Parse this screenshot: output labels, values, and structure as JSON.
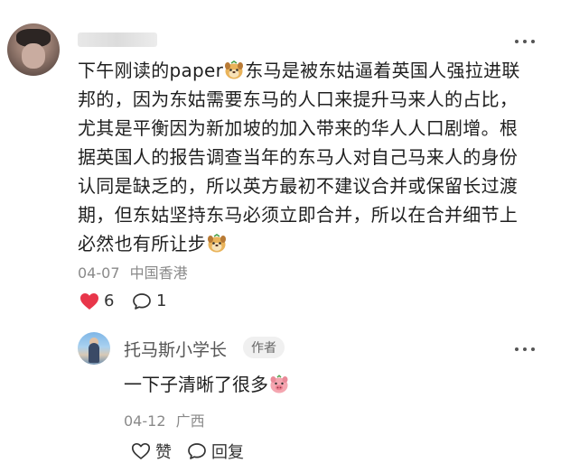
{
  "comment": {
    "author_blurred": true,
    "text_lines": [
      "下午刚读的paper",
      "东马是被东姑逼着英国人强拉进联",
      "邦的，因为东姑需要东马的人口来提升马来人的占比，",
      "尤其是平衡因为新加坡的加入带来的华人人口剧增。根",
      "据英国人的报告调查当年的东马人对自己马来人的身份",
      "认同是缺乏的，所以英方最初不建议合并或保留长过渡",
      "期，但东姑坚持东马必须立即合并，所以在合并细节上",
      "必然也有所让步"
    ],
    "emoji_icons": [
      "dog-face-emoji",
      "dog-face-emoji"
    ],
    "date": "04-07",
    "location": "中国香港",
    "like_count": "6",
    "reply_count": "1",
    "like_icon_color": "#e8364a"
  },
  "reply": {
    "author": "托马斯小学长",
    "badge": "作者",
    "text": "一下子清晰了很多",
    "emoji_icon": "pig-face-emoji",
    "date": "04-12",
    "location": "广西",
    "like_label": "赞",
    "reply_label": "回复"
  }
}
